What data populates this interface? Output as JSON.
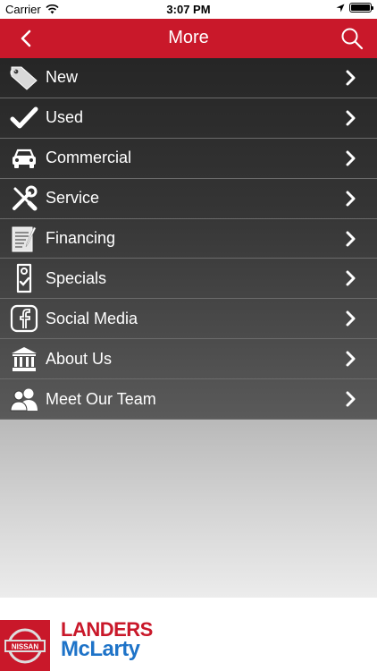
{
  "status_bar": {
    "carrier": "Carrier",
    "time": "3:07 PM"
  },
  "nav": {
    "title": "More"
  },
  "menu": {
    "items": [
      {
        "label": "New",
        "icon": "tag-icon"
      },
      {
        "label": "Used",
        "icon": "checkmark-icon"
      },
      {
        "label": "Commercial",
        "icon": "car-icon"
      },
      {
        "label": "Service",
        "icon": "wrench-screwdriver-icon"
      },
      {
        "label": "Financing",
        "icon": "document-pen-icon"
      },
      {
        "label": "Specials",
        "icon": "door-hanger-icon"
      },
      {
        "label": "Social Media",
        "icon": "facebook-icon"
      },
      {
        "label": "About Us",
        "icon": "bank-building-icon"
      },
      {
        "label": "Meet Our Team",
        "icon": "people-icon"
      }
    ]
  },
  "footer": {
    "brand_line1": "LANDERS",
    "brand_line2": "McLarty",
    "nissan_text": "NISSAN"
  },
  "colors": {
    "accent_red": "#c9182a",
    "brand_blue": "#1e73c8"
  }
}
